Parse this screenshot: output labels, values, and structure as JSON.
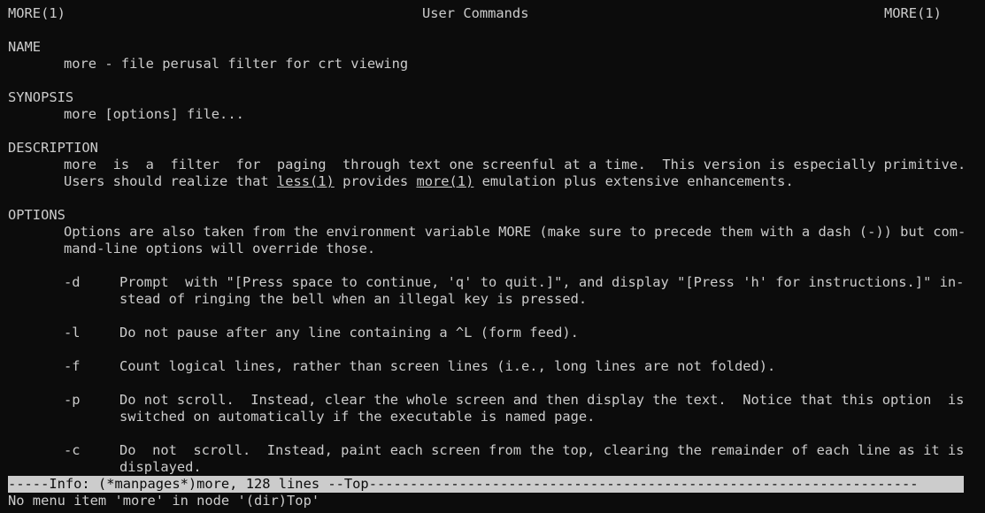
{
  "header": {
    "left": "MORE(1)",
    "center": "User Commands",
    "right": "MORE(1)"
  },
  "sections": {
    "name": {
      "heading": "NAME",
      "text": "more - file perusal filter for crt viewing"
    },
    "synopsis": {
      "heading": "SYNOPSIS",
      "text": "more [options] file..."
    },
    "description": {
      "heading": "DESCRIPTION",
      "line1": "more  is  a  filter  for  paging  through text one screenful at a time.  This version is especially primitive.",
      "line2_before": "Users should realize that ",
      "link_less": "less(1)",
      "line2_middle": " provides ",
      "link_more": "more(1)",
      "line2_after": " emulation plus extensive enhancements."
    },
    "options": {
      "heading": "OPTIONS",
      "intro1": "Options are also taken from the environment variable MORE (make sure to precede them with a dash (-)) but com-",
      "intro2": "mand-line options will override those.",
      "items": [
        {
          "flag": "-d",
          "lines": [
            "Prompt  with \"[Press space to continue, 'q' to quit.]\", and display \"[Press 'h' for instructions.]\" in-",
            "stead of ringing the bell when an illegal key is pressed."
          ]
        },
        {
          "flag": "-l",
          "lines": [
            "Do not pause after any line containing a ^L (form feed)."
          ]
        },
        {
          "flag": "-f",
          "lines": [
            "Count logical lines, rather than screen lines (i.e., long lines are not folded)."
          ]
        },
        {
          "flag": "-p",
          "lines": [
            "Do not scroll.  Instead, clear the whole screen and then display the text.  Notice that this option  is",
            "switched on automatically if the executable is named page."
          ]
        },
        {
          "flag": "-c",
          "lines": [
            "Do  not  scroll.  Instead, paint each screen from the top, clearing the remainder of each line as it is",
            "displayed."
          ]
        }
      ]
    }
  },
  "modeline": "-----Info: (*manpages*)more, 128 lines --Top-------------------------------------------------------------------",
  "echo_area": "No menu item 'more' in node '(dir)Top'"
}
